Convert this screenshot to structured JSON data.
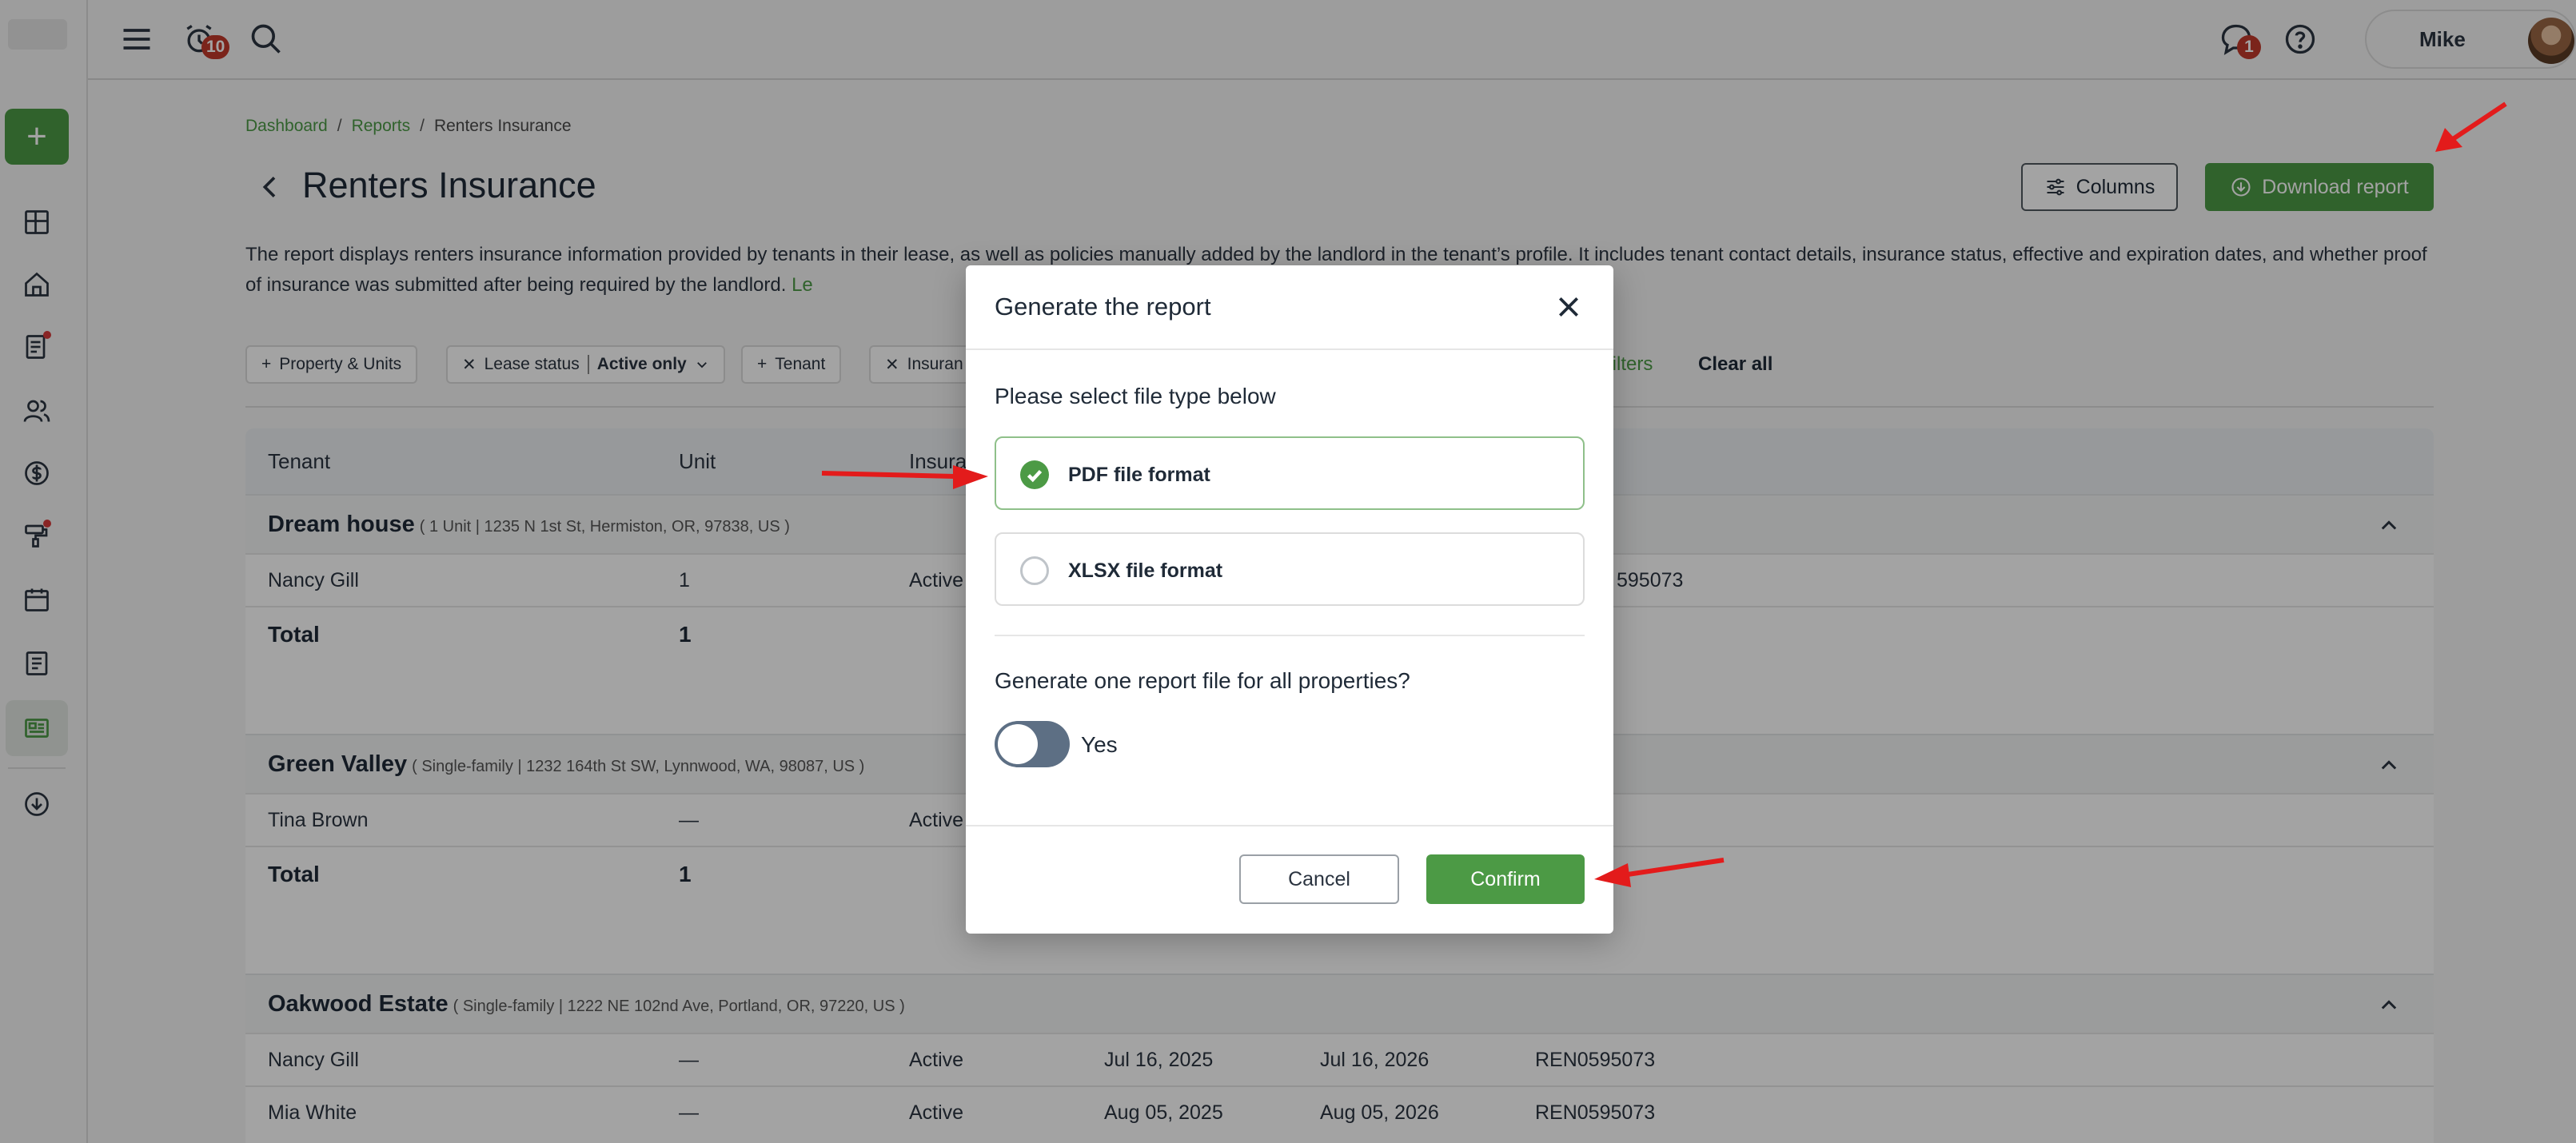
{
  "colors": {
    "accent": "#4c9a45",
    "badge": "#c0392b",
    "annotation_arrow": "#e31b1b"
  },
  "topbar": {
    "notifications_badge": "10",
    "messages_badge": "1",
    "user_name": "Mike"
  },
  "breadcrumb": [
    "Dashboard",
    "Reports",
    "Renters Insurance"
  ],
  "page": {
    "title": "Renters Insurance",
    "columns_label": "Columns",
    "download_label": "Download report",
    "description": "The report displays renters insurance information provided by tenants in their lease, as well as policies manually added by the landlord in the tenant’s profile. It includes tenant contact details, insurance status, effective and expiration dates, and whether proof of insurance was submitted after being required by the landlord.",
    "learn_more": "Le"
  },
  "filters": {
    "property_units": "Property & Units",
    "lease_status_label": "Lease status",
    "lease_status_value": "Active only",
    "tenant": "Tenant",
    "insurance": "Insuran",
    "more_filters": "e filters",
    "clear_all": "Clear all"
  },
  "table": {
    "headers": {
      "tenant": "Tenant",
      "unit": "Unit",
      "insurance": "Insura"
    },
    "groups": [
      {
        "name": "Dream house",
        "details": "( 1 Unit | 1235 N 1st St, Hermiston, OR, 97838, US )",
        "rows": [
          {
            "tenant": "Nancy Gill",
            "unit": "1",
            "status": "Active",
            "start": "",
            "end": "",
            "policy": "595073"
          }
        ],
        "total_label": "Total",
        "total_value": "1"
      },
      {
        "name": "Green Valley",
        "details": "( Single-family | 1232 164th St SW, Lynnwood, WA, 98087, US )",
        "rows": [
          {
            "tenant": "Tina Brown",
            "unit": "—",
            "status": "Active",
            "start": "",
            "end": "",
            "policy": ""
          }
        ],
        "total_label": "Total",
        "total_value": "1"
      },
      {
        "name": "Oakwood Estate",
        "details": "( Single-family | 1222 NE 102nd Ave, Portland, OR, 97220, US )",
        "rows": [
          {
            "tenant": "Nancy Gill",
            "unit": "—",
            "status": "Active",
            "start": "Jul 16, 2025",
            "end": "Jul 16, 2026",
            "policy": "REN0595073"
          },
          {
            "tenant": "Mia White",
            "unit": "—",
            "status": "Active",
            "start": "Aug 05, 2025",
            "end": "Aug 05, 2026",
            "policy": "REN0595073"
          }
        ]
      }
    ]
  },
  "modal": {
    "title": "Generate the report",
    "file_type_prompt": "Please select file type below",
    "options": [
      {
        "label": "PDF file format",
        "selected": true
      },
      {
        "label": "XLSX file format",
        "selected": false
      }
    ],
    "single_file_prompt": "Generate one report file for all properties?",
    "toggle_label": "Yes",
    "toggle_on": false,
    "cancel_label": "Cancel",
    "confirm_label": "Confirm"
  }
}
